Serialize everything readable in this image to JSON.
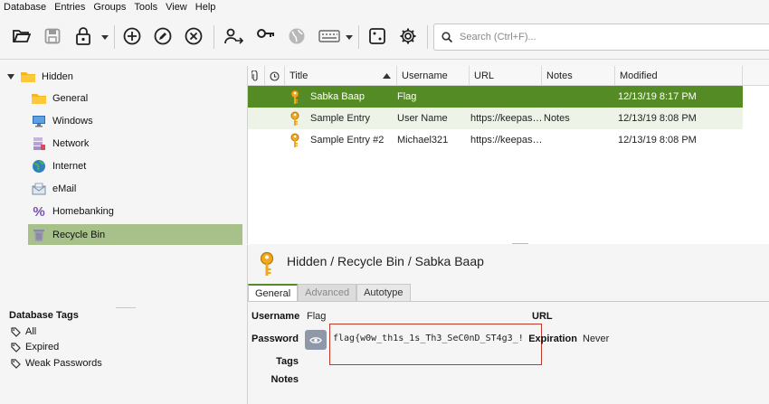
{
  "menu": [
    "Database",
    "Entries",
    "Groups",
    "Tools",
    "View",
    "Help"
  ],
  "toolbar": {
    "search_placeholder": "Search (Ctrl+F)..."
  },
  "colors": {
    "selection_green": "#548b25",
    "tree_selection": "#a8c08a",
    "highlight_red": "#c0392b"
  },
  "tree": {
    "root": "Hidden",
    "groups": [
      "General",
      "Windows",
      "Network",
      "Internet",
      "eMail",
      "Homebanking",
      "Recycle Bin"
    ]
  },
  "tags": {
    "title": "Database Tags",
    "items": [
      "All",
      "Expired",
      "Weak Passwords"
    ]
  },
  "table": {
    "columns": [
      "Title",
      "Username",
      "URL",
      "Notes",
      "Modified"
    ],
    "rows": [
      {
        "title": "Sabka Baap",
        "username": "Flag",
        "url": "",
        "notes": "",
        "modified": "12/13/19 8:17 PM"
      },
      {
        "title": "Sample Entry",
        "username": "User Name",
        "url": "https://keepas…",
        "notes": "Notes",
        "modified": "12/13/19 8:08 PM"
      },
      {
        "title": "Sample Entry #2",
        "username": "Michael321",
        "url": "https://keepas…",
        "notes": "",
        "modified": "12/13/19 8:08 PM"
      }
    ]
  },
  "detail": {
    "path": "Hidden / Recycle Bin / Sabka Baap",
    "tabs": [
      "General",
      "Advanced",
      "Autotype"
    ],
    "labels": {
      "username": "Username",
      "password": "Password",
      "tags": "Tags",
      "notes": "Notes",
      "url": "URL",
      "expiration": "Expiration"
    },
    "username": "Flag",
    "password": "flag{w0w_th1s_1s_Th3_SeC0nD_ST4g3_!",
    "expiration": "Never"
  }
}
